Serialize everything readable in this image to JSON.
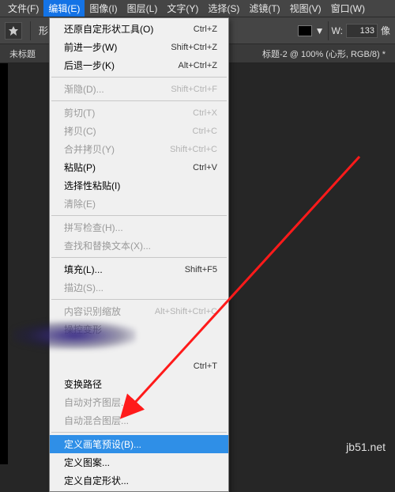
{
  "menubar": {
    "items": [
      "文件(F)",
      "编辑(E)",
      "图像(I)",
      "图层(L)",
      "文字(Y)",
      "选择(S)",
      "滤镜(T)",
      "视图(V)",
      "窗口(W)"
    ],
    "active_index": 1
  },
  "toolbar": {
    "shape_label": "形",
    "w_label": "W:",
    "w_value": "133",
    "w_unit": "像"
  },
  "docbar": {
    "left_tab": "未标题",
    "right_tab": "标题-2 @ 100% (心形, RGB/8) *"
  },
  "menu": {
    "groups": [
      [
        {
          "label": "还原自定形状工具(O)",
          "shortcut": "Ctrl+Z",
          "enabled": true
        },
        {
          "label": "前进一步(W)",
          "shortcut": "Shift+Ctrl+Z",
          "enabled": true
        },
        {
          "label": "后退一步(K)",
          "shortcut": "Alt+Ctrl+Z",
          "enabled": true
        }
      ],
      [
        {
          "label": "渐隐(D)...",
          "shortcut": "Shift+Ctrl+F",
          "enabled": false
        }
      ],
      [
        {
          "label": "剪切(T)",
          "shortcut": "Ctrl+X",
          "enabled": false
        },
        {
          "label": "拷贝(C)",
          "shortcut": "Ctrl+C",
          "enabled": false
        },
        {
          "label": "合并拷贝(Y)",
          "shortcut": "Shift+Ctrl+C",
          "enabled": false
        },
        {
          "label": "粘贴(P)",
          "shortcut": "Ctrl+V",
          "enabled": true
        },
        {
          "label": "选择性粘贴(I)",
          "shortcut": "",
          "enabled": true
        },
        {
          "label": "清除(E)",
          "shortcut": "",
          "enabled": false
        }
      ],
      [
        {
          "label": "拼写检查(H)...",
          "shortcut": "",
          "enabled": false
        },
        {
          "label": "查找和替换文本(X)...",
          "shortcut": "",
          "enabled": false
        }
      ],
      [
        {
          "label": "填充(L)...",
          "shortcut": "Shift+F5",
          "enabled": true
        },
        {
          "label": "描边(S)...",
          "shortcut": "",
          "enabled": false
        }
      ],
      [
        {
          "label": "内容识别缩放",
          "shortcut": "Alt+Shift+Ctrl+C",
          "enabled": false
        },
        {
          "label": "操控变形",
          "shortcut": "",
          "enabled": false
        },
        {
          "label": "",
          "shortcut": "",
          "enabled": false,
          "obscured": true
        },
        {
          "label": "",
          "shortcut": "Ctrl+T",
          "enabled": true,
          "obscured": true
        },
        {
          "label": "变换路径",
          "shortcut": "",
          "enabled": true
        },
        {
          "label": "自动对齐图层...",
          "shortcut": "",
          "enabled": false
        },
        {
          "label": "自动混合图层...",
          "shortcut": "",
          "enabled": false
        }
      ],
      [
        {
          "label": "定义画笔预设(B)...",
          "shortcut": "",
          "enabled": true,
          "highlight": true
        },
        {
          "label": "定义图案...",
          "shortcut": "",
          "enabled": true
        },
        {
          "label": "定义自定形状...",
          "shortcut": "",
          "enabled": true
        }
      ]
    ]
  },
  "watermark": "jb51.net"
}
